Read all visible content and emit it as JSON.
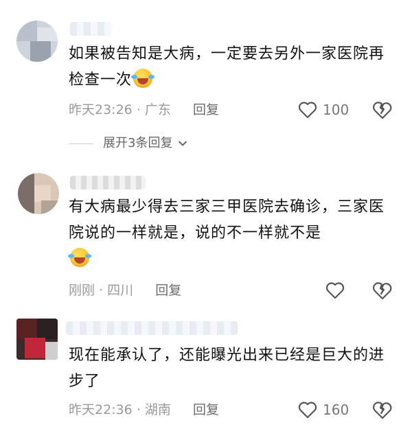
{
  "comments": [
    {
      "text": "如果被告知是大病，一定要去另外一家医院再检查一次",
      "emoji": "laughing-crying-emoji",
      "time": "昨天23:26",
      "location": "广东",
      "reply_label": "回复",
      "likes": "100"
    },
    {
      "text": "有大病最少得去三家三甲医院去确诊，三家医院说的一样就是，说的不一样就不是",
      "emoji": "laughing-crying-emoji",
      "time": "刚刚",
      "location": "四川",
      "reply_label": "回复",
      "likes": ""
    },
    {
      "text": "现在能承认了，还能曝光出来已经是巨大的进步了",
      "emoji": "",
      "time": "昨天22:36",
      "location": "湖南",
      "reply_label": "回复",
      "likes": "160"
    }
  ],
  "expand_replies": "展开3条回复",
  "separator": "·"
}
